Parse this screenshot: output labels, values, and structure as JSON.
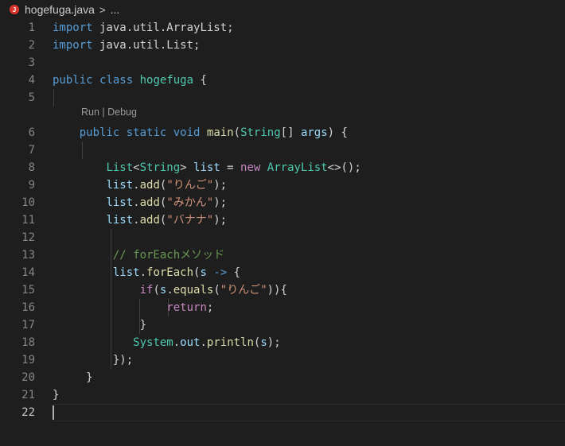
{
  "tab": {
    "filename": "hogefuga.java",
    "file_icon_letter": "J",
    "chevron": ">",
    "more": "..."
  },
  "codelens": "Run | Debug",
  "lines": {
    "l1": {
      "n": "1",
      "a": "import",
      "b": " java.util.ArrayList;"
    },
    "l2": {
      "n": "2",
      "a": "import",
      "b": " java.util.List;"
    },
    "l3": {
      "n": "3"
    },
    "l4": {
      "n": "4",
      "a": "public",
      "b": " ",
      "c": "class",
      "d": " ",
      "e": "hogefuga",
      "f": " {"
    },
    "l5": {
      "n": "5"
    },
    "l6": {
      "n": "6",
      "a": "public",
      "b": " ",
      "c": "static",
      "d": " ",
      "e": "void",
      "f": " ",
      "g": "main",
      "h": "(",
      "i": "String",
      "j": "[] ",
      "k": "args",
      "l": ") {"
    },
    "l7": {
      "n": "7"
    },
    "l8": {
      "n": "8",
      "a": "List",
      "b": "<",
      "c": "String",
      "d": "> ",
      "e": "list",
      "f": " = ",
      "g": "new",
      "h": " ",
      "i": "ArrayList",
      "j": "<>();"
    },
    "l9": {
      "n": "9",
      "a": "list",
      "b": ".",
      "c": "add",
      "d": "(",
      "e": "\"りんご\"",
      "f": ");"
    },
    "l10": {
      "n": "10",
      "a": "list",
      "b": ".",
      "c": "add",
      "d": "(",
      "e": "\"みかん\"",
      "f": ");"
    },
    "l11": {
      "n": "11",
      "a": "list",
      "b": ".",
      "c": "add",
      "d": "(",
      "e": "\"バナナ\"",
      "f": ");"
    },
    "l12": {
      "n": "12"
    },
    "l13": {
      "n": "13",
      "a": "// forEachメソッド"
    },
    "l14": {
      "n": "14",
      "a": "list",
      "b": ".",
      "c": "forEach",
      "d": "(",
      "e": "s",
      "f": " ",
      "g": "->",
      "h": " {"
    },
    "l15": {
      "n": "15",
      "a": "if",
      "b": "(",
      "c": "s",
      "d": ".",
      "e": "equals",
      "f": "(",
      "g": "\"りんご\"",
      "h": ")){"
    },
    "l16": {
      "n": "16",
      "a": "return",
      "b": ";"
    },
    "l17": {
      "n": "17",
      "a": "}"
    },
    "l18": {
      "n": "18",
      "a": "System",
      "b": ".",
      "c": "out",
      "d": ".",
      "e": "println",
      "f": "(",
      "g": "s",
      "h": ");"
    },
    "l19": {
      "n": "19",
      "a": "});"
    },
    "l20": {
      "n": "20",
      "a": "}"
    },
    "l21": {
      "n": "21",
      "a": "}"
    },
    "l22": {
      "n": "22"
    }
  },
  "colors": {
    "background": "#1e1e1e",
    "keyword": "#569cd6",
    "control_keyword": "#c586c0",
    "type": "#4ec9b0",
    "function": "#dcdcaa",
    "variable": "#9cdcfe",
    "string": "#ce9178",
    "comment": "#6a9955"
  }
}
